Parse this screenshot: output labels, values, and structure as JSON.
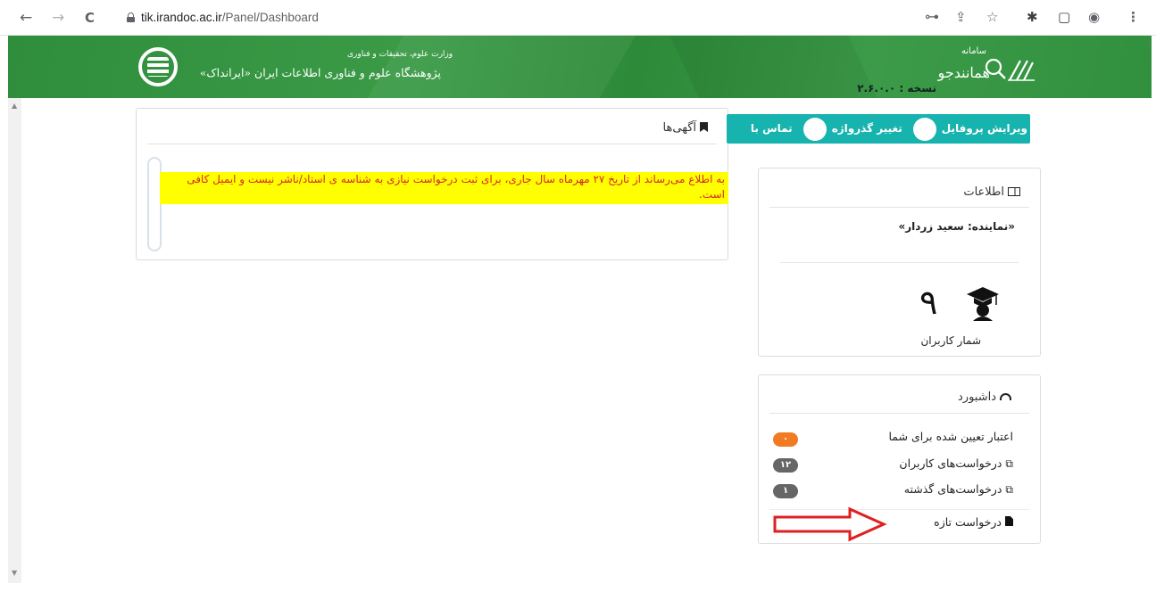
{
  "browser": {
    "url_host": "tik.irandoc.ac.ir",
    "url_path": "/Panel/Dashboard",
    "back_glyph": "←",
    "forward_glyph": "→",
    "reload_glyph": "C",
    "key_glyph": "⊶",
    "share_glyph": "⇪",
    "star_glyph": "☆",
    "ext_glyph": "✱",
    "panel_glyph": "▢",
    "profile_glyph": "◉",
    "menu_glyph": "⋮"
  },
  "header": {
    "institute_small": "وزارت علوم، تحقیقات و فناوری",
    "institute_name": "پژوهشگاه علوم و فناوری اطلاعات ایران «ایرانداک»",
    "brand_small": "سامانه",
    "brand_name": "همانندجو",
    "version": "نسخه : ۲.۶.۰.۰"
  },
  "actions": {
    "edit_profile": "ویرایش پروفایل",
    "change_password": "تغییر گذرواژه",
    "contact": "تماس با"
  },
  "announcements": {
    "title": "آگهی‌ها",
    "icon": "bookmark-icon",
    "text": "به اطلاع می‌رساند از تاریخ ۲۷ مهرماه سال جاری، برای ثبت درخواست نیازی به شناسه ی استاد/ناشر نیست و ایمیل کافی است."
  },
  "info": {
    "title": "اطلاعات",
    "icon": "id-card-icon",
    "representative": "«نماینده: سعید زردار»",
    "user_count": "۹",
    "user_count_label": "شمار کاربران"
  },
  "dashboard": {
    "title": "داشبورد",
    "icon": "dashboard-icon",
    "rows": [
      {
        "label": "اعتبار تعیین شده برای شما",
        "badge": "۰",
        "badge_color": "#f07b22"
      },
      {
        "label": "درخواست‌های کاربران",
        "badge": "۱۲",
        "badge_color": "#666666"
      },
      {
        "label": "درخواست‌های گذشته",
        "badge": "۱",
        "badge_color": "#666666"
      },
      {
        "label": "درخواست تازه"
      }
    ]
  },
  "colors": {
    "header_green": "#3a9a46",
    "teal_bar": "#17b3ae",
    "highlight_yellow": "#ffff00",
    "alert_red": "#d52a2a",
    "annotation_red": "#e02020"
  }
}
